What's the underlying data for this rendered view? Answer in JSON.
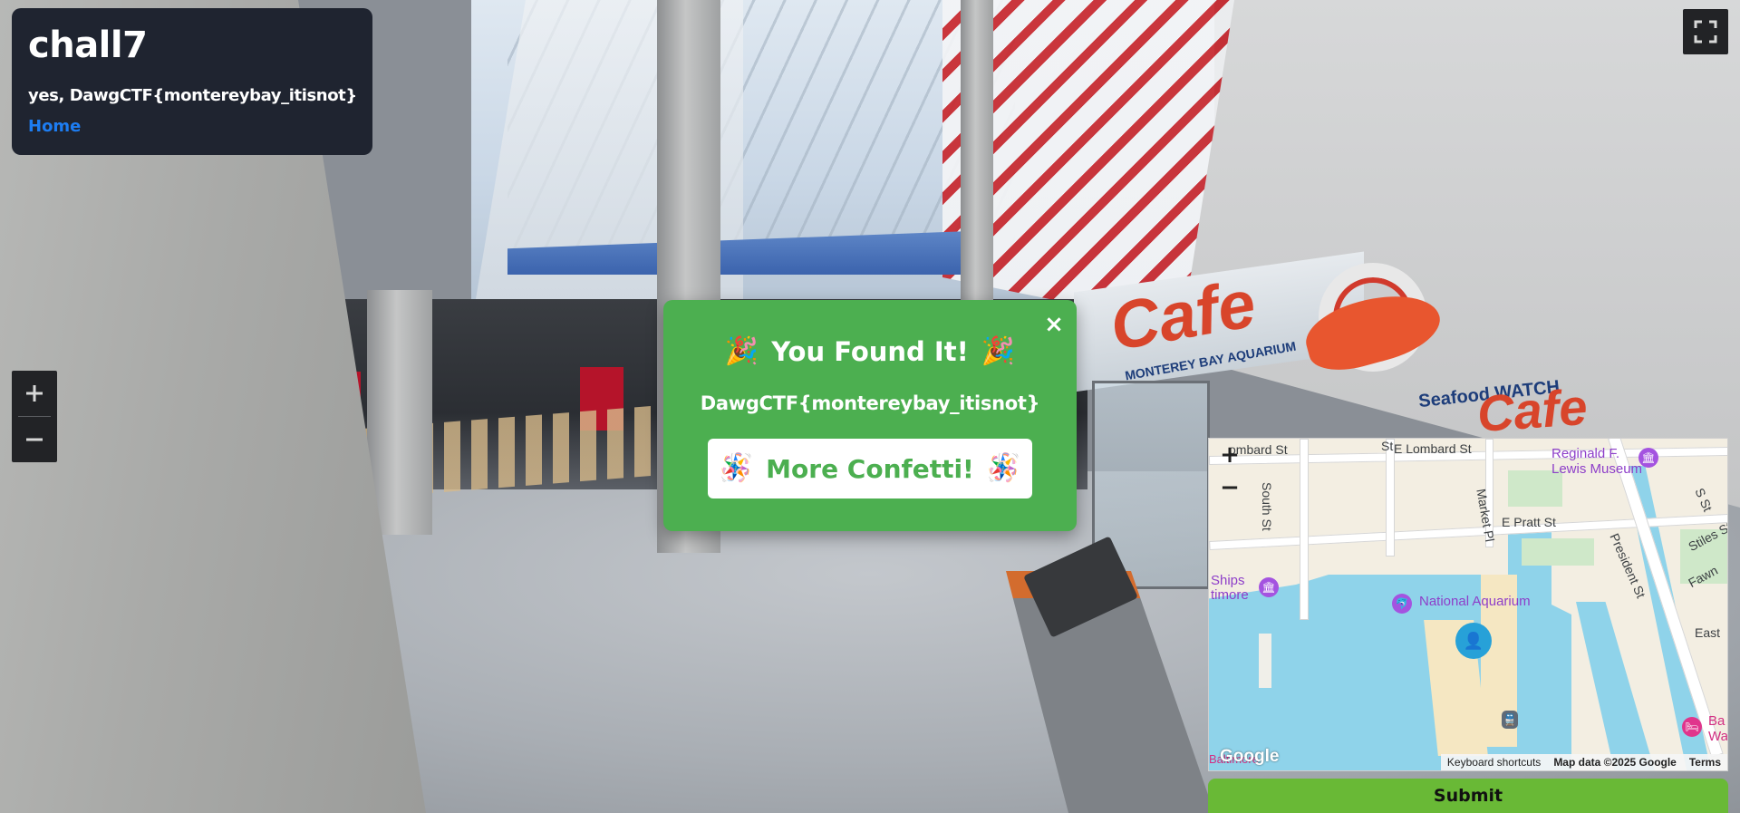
{
  "panel": {
    "title": "chall7",
    "message": "yes, DawgCTF{montereybay_itisnot}",
    "home_link": "Home"
  },
  "streetview": {
    "fullscreen_icon": "fullscreen-icon",
    "zoom_in_icon": "plus-icon",
    "zoom_out_icon": "minus-icon",
    "signs": {
      "cafe": "Cafe",
      "cafe_sub": "MONTEREY BAY AQUARIUM",
      "seafood_watch": "Seafood WATCH",
      "cafe_two": "Cafe"
    }
  },
  "modal": {
    "close_symbol": "×",
    "heading": "You Found It!",
    "heading_icon": "🎉",
    "flag": "DawgCTF{montereybay_itisnot}",
    "confetti_label": "More Confetti!",
    "confetti_icon": "🪅"
  },
  "map": {
    "zoom_in": "+",
    "zoom_out": "−",
    "labels": {
      "e_lombard_left": "ombard St",
      "st_fragment": "St",
      "e_lombard": "E Lombard St",
      "south_st": "South St",
      "market_pl": "Market Pl",
      "reginald_1": "Reginald F.",
      "reginald_2": "Lewis Museum",
      "e_pratt": "E Pratt St",
      "president_st": "President St",
      "stiles_st": "Stiles St",
      "s_st": "S St",
      "fawn": "Fawn",
      "east": "East",
      "ships_1": "Ships",
      "ships_2": "timore",
      "national_aquarium": "National Aquarium",
      "bal_1": "Ba",
      "bal_2": "Wa",
      "bottom_left": "Baltimore"
    },
    "google_logo": "Google",
    "footer": {
      "shortcuts": "Keyboard shortcuts",
      "map_data": "Map data ©2025 Google",
      "terms": "Terms"
    }
  },
  "submit_label": "Submit",
  "colors": {
    "panel_bg": "#1f2430",
    "link": "#1d7df2",
    "modal_bg": "#4caf50",
    "submit_bg": "#69b936"
  }
}
